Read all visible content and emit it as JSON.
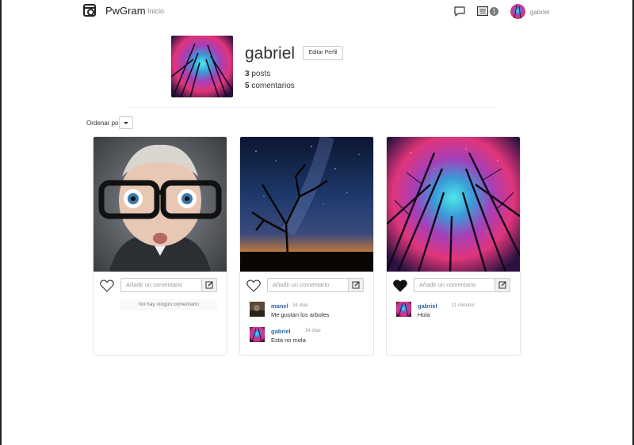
{
  "nav": {
    "brand": "PwGram",
    "home_link": "Inicio",
    "notification_count": "1",
    "username": "gabriel"
  },
  "profile": {
    "name": "gabriel",
    "edit_button": "Editar Perfil",
    "posts_count": "3",
    "posts_label": "posts",
    "comments_count": "5",
    "comments_label": "comentarios"
  },
  "sort": {
    "label": "Ordenar por"
  },
  "posts": [
    {
      "image": "child-with-glasses-photo",
      "liked": false,
      "comment_placeholder": "Añadir un comentario",
      "empty_text": "No hay ningún comentario",
      "comments": []
    },
    {
      "image": "night-sky-tree-photo",
      "liked": false,
      "comment_placeholder": "Añadir un comentario",
      "comments": [
        {
          "user": "manel",
          "time": "34 días",
          "text": "Me gustan los arboles"
        },
        {
          "user": "gabriel",
          "time": "34 días",
          "text": "Esta no mola"
        }
      ]
    },
    {
      "image": "purple-forest-sky-photo",
      "liked": true,
      "comment_placeholder": "Añadir un comentario",
      "comments": [
        {
          "user": "gabriel",
          "time": "11 minutos",
          "text": "Hola"
        }
      ]
    }
  ],
  "colors": {
    "username_link": "#2d6a9f",
    "badge": "#777777",
    "text": "#333333"
  }
}
